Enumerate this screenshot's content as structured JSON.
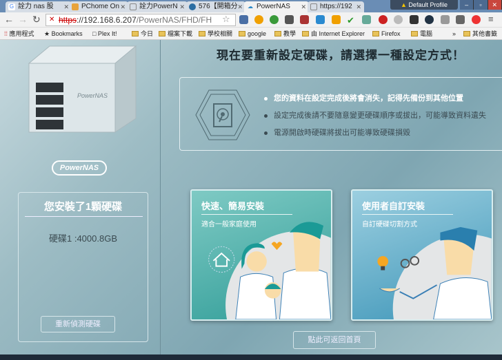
{
  "browser": {
    "tabs": [
      {
        "label": "詮力 nas 股"
      },
      {
        "label": "PChome On"
      },
      {
        "label": "詮力PowerN"
      },
      {
        "label": "576【開箱分"
      },
      {
        "label": "PowerNAS",
        "active": true
      },
      {
        "label": "https://192"
      }
    ],
    "profile": "Default Profile",
    "url": {
      "scheme": "https",
      "rest": "://192.168.6.207",
      "path": "/PowerNAS/FHD/FH"
    },
    "bookmarks": [
      "應用程式",
      "Bookmarks",
      "□ Plex It!",
      "今日",
      "檔案下載",
      "學校相關",
      "google",
      "教學",
      "由 Internet Explorer",
      "Firefox",
      "電腦",
      "»",
      "其他書籤"
    ]
  },
  "sidebar": {
    "logo": "PowerNAS",
    "disk_panel": {
      "title": "您安裝了1顆硬碟",
      "disks": [
        "硬碟1 :4000.8GB"
      ],
      "redetect_label": "重新偵測硬碟"
    }
  },
  "main": {
    "title": "現在要重新設定硬碟，請選擇一種設定方式！",
    "warnings": [
      "您的資料在設定完成後將會消失，記得先備份到其他位置",
      "設定完成後請不要隨意變更硬碟順序或拔出，可能導致資料遺失",
      "電源開啟時硬碟將拔出可能導致硬碟損毀"
    ],
    "options": [
      {
        "title": "快速、簡易安裝",
        "subtitle": "適合一般家庭使用"
      },
      {
        "title": "使用者自訂安裝",
        "subtitle": "自訂硬碟切割方式"
      }
    ],
    "back_label": "點此可返回首頁"
  },
  "colors": {
    "accent_teal": "#2f9c97",
    "accent_blue": "#3d95b8"
  }
}
